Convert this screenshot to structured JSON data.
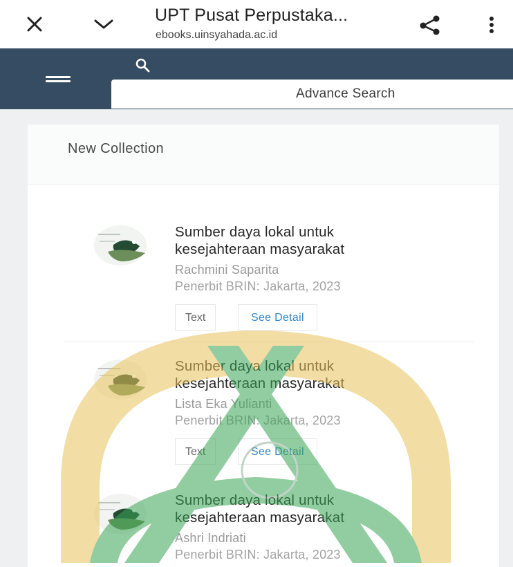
{
  "browser": {
    "page_title": "UPT Pusat Perpustaka...",
    "url": "ebooks.uinsyahada.ac.id",
    "icons": [
      "close-icon",
      "chevron-down-icon",
      "share-icon",
      "more-vert-icon"
    ]
  },
  "header": {
    "icons": [
      "hamburger-menu-icon",
      "search-icon"
    ],
    "advance_search_label": "Advance Search"
  },
  "collection": {
    "title": "New Collection",
    "items": [
      {
        "title_line1": "Sumber daya lokal untuk",
        "title_line2": "kesejahteraan masyarakat",
        "author": "Rachmini Saparita",
        "publisher": "Penerbit BRIN: Jakarta, 2023",
        "tag": "Text",
        "detail_label": "See Detail"
      },
      {
        "title_line1": "Sumber daya lokal untuk",
        "title_line2": "kesejahteraan masyarakat",
        "author": "Lista Eka Yulianti",
        "publisher": "Penerbit BRIN: Jakarta, 2023",
        "tag": "Text",
        "detail_label": "See Detail"
      },
      {
        "title_line1": "Sumber daya lokal untuk",
        "title_line2": "kesejahteraan masyarakat",
        "author": "Ashri Indriati",
        "publisher": "Penerbit BRIN: Jakarta, 2023"
      }
    ]
  },
  "colors": {
    "header_bg": "#354c63",
    "link_blue": "#3386c7",
    "watermark_gold": "#e9c25a",
    "watermark_green": "#3aa555"
  }
}
